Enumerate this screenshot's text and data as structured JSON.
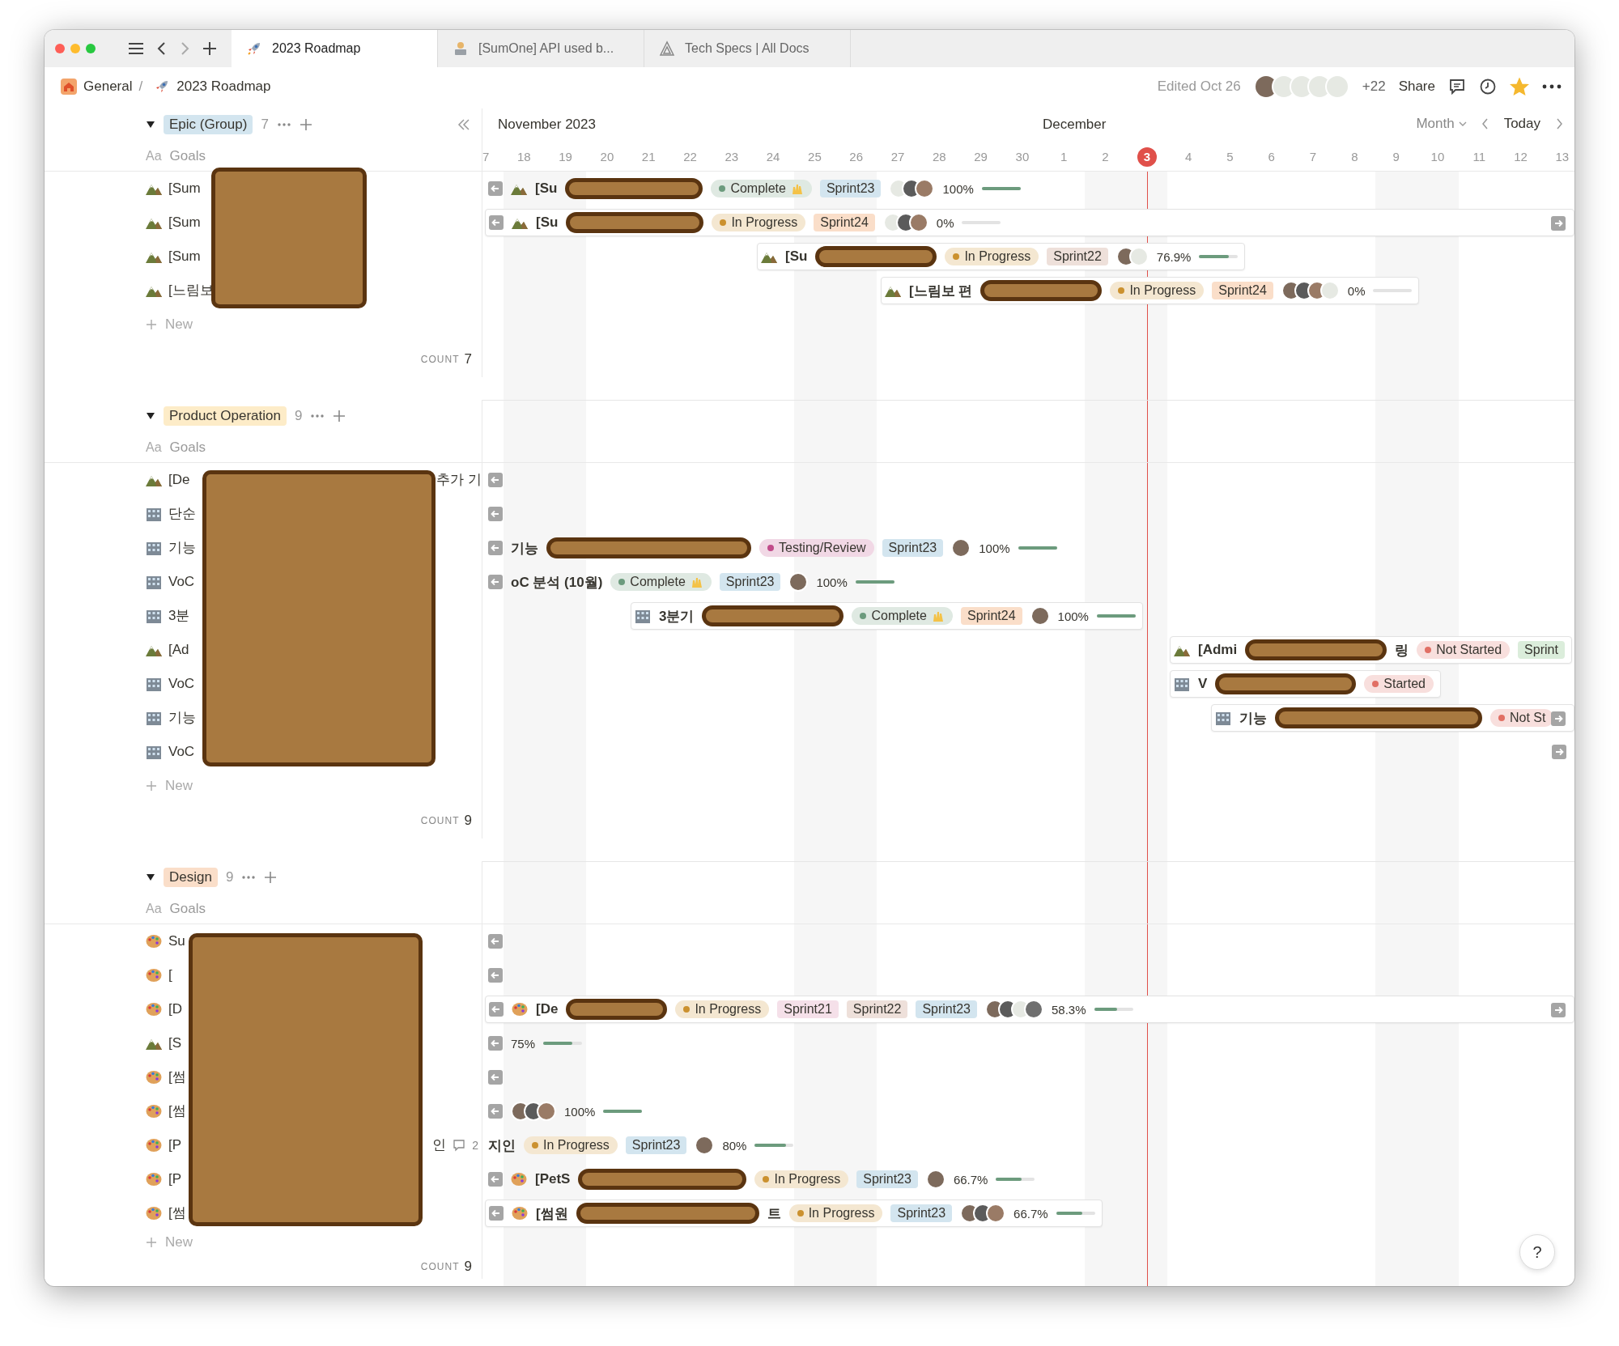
{
  "window": {
    "tabs": [
      {
        "label": "2023 Roadmap",
        "selected": true
      },
      {
        "label": "[SumOne] API used b...",
        "selected": false
      },
      {
        "label": "Tech Specs | All Docs",
        "selected": false
      }
    ]
  },
  "breadcrumb": {
    "items": [
      {
        "label": "General"
      },
      {
        "label": "2023 Roadmap"
      }
    ],
    "separator": "/"
  },
  "toolbar": {
    "edited": "Edited Oct 26",
    "avatars": [
      {
        "kind": "photo"
      },
      {
        "kind": "sticker"
      },
      {
        "kind": "sticker"
      },
      {
        "kind": "sticker"
      },
      {
        "kind": "sticker"
      }
    ],
    "more_people": "+22",
    "share": "Share",
    "favorite": true
  },
  "timeline": {
    "months": [
      "November 2023",
      "December"
    ],
    "view": "Month",
    "today": "Today",
    "days": [
      {
        "label": "7",
        "weekend": false,
        "today": false
      },
      {
        "label": "18",
        "weekend": true,
        "today": false
      },
      {
        "label": "19",
        "weekend": true,
        "today": false
      },
      {
        "label": "20",
        "weekend": false,
        "today": false
      },
      {
        "label": "21",
        "weekend": false,
        "today": false
      },
      {
        "label": "22",
        "weekend": false,
        "today": false
      },
      {
        "label": "23",
        "weekend": false,
        "today": false
      },
      {
        "label": "24",
        "weekend": false,
        "today": false
      },
      {
        "label": "25",
        "weekend": true,
        "today": false
      },
      {
        "label": "26",
        "weekend": true,
        "today": false
      },
      {
        "label": "27",
        "weekend": false,
        "today": false
      },
      {
        "label": "28",
        "weekend": false,
        "today": false
      },
      {
        "label": "29",
        "weekend": false,
        "today": false
      },
      {
        "label": "30",
        "weekend": false,
        "today": false
      },
      {
        "label": "1",
        "weekend": false,
        "today": false
      },
      {
        "label": "2",
        "weekend": true,
        "today": false
      },
      {
        "label": "3",
        "weekend": true,
        "today": true
      },
      {
        "label": "4",
        "weekend": false,
        "today": false
      },
      {
        "label": "5",
        "weekend": false,
        "today": false
      },
      {
        "label": "6",
        "weekend": false,
        "today": false
      },
      {
        "label": "7",
        "weekend": false,
        "today": false
      },
      {
        "label": "8",
        "weekend": false,
        "today": false
      },
      {
        "label": "9",
        "weekend": true,
        "today": false
      },
      {
        "label": "10",
        "weekend": true,
        "today": false
      },
      {
        "label": "11",
        "weekend": false,
        "today": false
      },
      {
        "label": "12",
        "weekend": false,
        "today": false
      },
      {
        "label": "13",
        "weekend": false,
        "today": false
      }
    ]
  },
  "groups": [
    {
      "name": "Epic (Group)",
      "color": "#d3e5ef",
      "count": "7",
      "column_icon": "Aa",
      "column": "Goals",
      "new_label": "New",
      "count_label": "COUNT",
      "total": "7",
      "rows": [
        {
          "kind": "mountain",
          "text": "[Sum",
          "bar": {
            "left_arrow": true,
            "kind": "mountain",
            "title": "[Su",
            "redacted": true,
            "status": {
              "label": "Complete",
              "color": "#6c9b7d",
              "celebrate": true
            },
            "sprints": [
              {
                "label": "Sprint23",
                "color": "#d3e5ef"
              }
            ],
            "avatars": [
              {
                "kind": "sticker"
              },
              {
                "kind": "photo"
              },
              {
                "kind": "photo"
              }
            ],
            "percent": "100%",
            "level": 1
          }
        },
        {
          "kind": "mountain",
          "text": "[Sum",
          "bar": {
            "left_arrow": true,
            "right_arrow": true,
            "card": true,
            "kind": "mountain",
            "title": "[Su",
            "redacted": true,
            "status": {
              "label": "In Progress",
              "color": "#cb912f"
            },
            "sprints": [
              {
                "label": "Sprint24",
                "color": "#fadec9"
              }
            ],
            "avatars": [
              {
                "kind": "sticker"
              },
              {
                "kind": "photo"
              },
              {
                "kind": "photo"
              }
            ],
            "percent": "0%",
            "level": 0
          }
        },
        {
          "kind": "mountain",
          "text": "[Sum",
          "bar": {
            "card": true,
            "kind": "mountain",
            "title": "[Su",
            "redacted": true,
            "status": {
              "label": "In Progress",
              "color": "#cb912f"
            },
            "sprints": [
              {
                "label": "Sprint22",
                "color": "#eee0da"
              }
            ],
            "avatars": [
              {
                "kind": "photo"
              },
              {
                "kind": "sticker"
              }
            ],
            "percent": "76.9%",
            "level": 0.769
          }
        },
        {
          "kind": "mountain",
          "text": "[느림보",
          "bar": {
            "card": true,
            "kind": "mountain",
            "title": "[느림보 편",
            "redacted": true,
            "status": {
              "label": "In Progress",
              "color": "#cb912f"
            },
            "sprints": [
              {
                "label": "Sprint24",
                "color": "#fadec9"
              }
            ],
            "avatars": [
              {
                "kind": "photo"
              },
              {
                "kind": "photo"
              },
              {
                "kind": "photo"
              },
              {
                "kind": "sticker"
              }
            ],
            "percent": "0%",
            "level": 0
          }
        }
      ]
    },
    {
      "name": "Product Operation",
      "color": "#fdecc8",
      "count": "9",
      "column_icon": "Aa",
      "column": "Goals",
      "new_label": "New",
      "count_label": "COUNT",
      "total": "9",
      "rows": [
        {
          "kind": "mountain",
          "text": "[De",
          "tail": "추가 기",
          "bar": {
            "left_arrow": true
          }
        },
        {
          "kind": "building",
          "text": "단순",
          "bar": {
            "left_arrow": true
          }
        },
        {
          "kind": "building",
          "text": "기능",
          "bar": {
            "left_arrow": true,
            "title": "기능",
            "redacted": true,
            "status": {
              "label": "Testing/Review",
              "color": "#c14c8a"
            },
            "sprints": [
              {
                "label": "Sprint23",
                "color": "#d3e5ef"
              }
            ],
            "avatars": [
              {
                "kind": "photo"
              }
            ],
            "percent": "100%",
            "level": 1
          }
        },
        {
          "kind": "building",
          "text": "VoC",
          "bar": {
            "left_arrow": true,
            "title": "oC 분석 (10월)",
            "status": {
              "label": "Complete",
              "color": "#6c9b7d",
              "celebrate": true
            },
            "sprints": [
              {
                "label": "Sprint23",
                "color": "#d3e5ef"
              }
            ],
            "avatars": [
              {
                "kind": "photo"
              }
            ],
            "percent": "100%",
            "level": 1
          }
        },
        {
          "kind": "building",
          "text": "3분",
          "bar": {
            "card": true,
            "kind": "building",
            "title": "3분기",
            "redacted": true,
            "status": {
              "label": "Complete",
              "color": "#6c9b7d",
              "celebrate": true
            },
            "sprints": [
              {
                "label": "Sprint24",
                "color": "#fadec9"
              }
            ],
            "avatars": [
              {
                "kind": "photo"
              }
            ],
            "percent": "100%",
            "level": 1
          }
        },
        {
          "kind": "mountain",
          "text": "[Ad",
          "bar": {
            "card": true,
            "kind": "mountain",
            "title": "[Admi",
            "redacted": true,
            "title_end": "링",
            "status": {
              "label": "Not Started",
              "color": "#e16f64"
            },
            "sprints": [
              {
                "label": "Sprint",
                "color": "#dbeddb"
              }
            ]
          }
        },
        {
          "kind": "building",
          "text": "VoC",
          "bar": {
            "card": true,
            "kind": "building",
            "title": "V",
            "redacted": true,
            "status": {
              "label": "Started",
              "color": "#e16f64"
            }
          }
        },
        {
          "kind": "building",
          "text": "기능",
          "bar": {
            "card": true,
            "right_arrow": true,
            "kind": "building",
            "title": "기능",
            "redacted": true,
            "status": {
              "label": "Not St",
              "color": "#e16f64"
            }
          }
        },
        {
          "kind": "building",
          "text": "VoC",
          "bar": {
            "right_arrow": true
          }
        }
      ]
    },
    {
      "name": "Design",
      "color": "#fadec9",
      "count": "9",
      "column_icon": "Aa",
      "column": "Goals",
      "new_label": "New",
      "count_label": "COUNT",
      "total": "9",
      "rows": [
        {
          "kind": "palette",
          "text": "Su",
          "bar": {
            "left_arrow": true
          }
        },
        {
          "kind": "palette",
          "text": "[",
          "bar": {
            "left_arrow": true
          }
        },
        {
          "kind": "palette",
          "text": "[D",
          "bar": {
            "left_arrow": true,
            "right_arrow": true,
            "card": true,
            "kind": "palette",
            "title": "[De",
            "redacted": true,
            "status": {
              "label": "In Progress",
              "color": "#cb912f"
            },
            "sprints": [
              {
                "label": "Sprint21",
                "color": "#f5e0e9"
              },
              {
                "label": "Sprint22",
                "color": "#eee0da"
              },
              {
                "label": "Sprint23",
                "color": "#d3e5ef"
              }
            ],
            "avatars": [
              {
                "kind": "photo"
              },
              {
                "kind": "photo"
              },
              {
                "kind": "sticker"
              },
              {
                "kind": "photo"
              }
            ],
            "percent": "58.3%",
            "level": 0.583
          }
        },
        {
          "kind": "mountain",
          "text": "[S",
          "bar": {
            "left_arrow": true,
            "percent": "75%",
            "level": 0.75
          }
        },
        {
          "kind": "palette",
          "text": "[썸",
          "bar": {
            "left_arrow": true
          }
        },
        {
          "kind": "palette",
          "text": "[썸",
          "bar": {
            "left_arrow": true,
            "avatars": [
              {
                "kind": "photo"
              },
              {
                "kind": "photo"
              },
              {
                "kind": "photo"
              }
            ],
            "percent": "100%",
            "level": 1
          }
        },
        {
          "kind": "palette",
          "text": "[P",
          "tail": "인",
          "comments": "2",
          "bar": {
            "title": "지인",
            "status": {
              "label": "In Progress",
              "color": "#cb912f"
            },
            "sprints": [
              {
                "label": "Sprint23",
                "color": "#d3e5ef"
              }
            ],
            "avatars": [
              {
                "kind": "photo"
              }
            ],
            "percent": "80%",
            "level": 0.8
          }
        },
        {
          "kind": "palette",
          "text": "[P",
          "bar": {
            "left_arrow": true,
            "kind": "palette",
            "title": "[PetS",
            "redacted": true,
            "status": {
              "label": "In Progress",
              "color": "#cb912f"
            },
            "sprints": [
              {
                "label": "Sprint23",
                "color": "#d3e5ef"
              }
            ],
            "avatars": [
              {
                "kind": "photo"
              }
            ],
            "percent": "66.7%",
            "level": 0.667
          }
        },
        {
          "kind": "palette",
          "text": "[썸",
          "bar": {
            "left_arrow": true,
            "card": true,
            "kind": "palette",
            "title": "[썸원",
            "redacted": true,
            "title_end": "트",
            "status": {
              "label": "In Progress",
              "color": "#cb912f"
            },
            "sprints": [
              {
                "label": "Sprint23",
                "color": "#d3e5ef"
              }
            ],
            "avatars": [
              {
                "kind": "photo"
              },
              {
                "kind": "photo"
              },
              {
                "kind": "photo"
              }
            ],
            "percent": "66.7%",
            "level": 0.667
          }
        }
      ]
    }
  ],
  "help": "?"
}
